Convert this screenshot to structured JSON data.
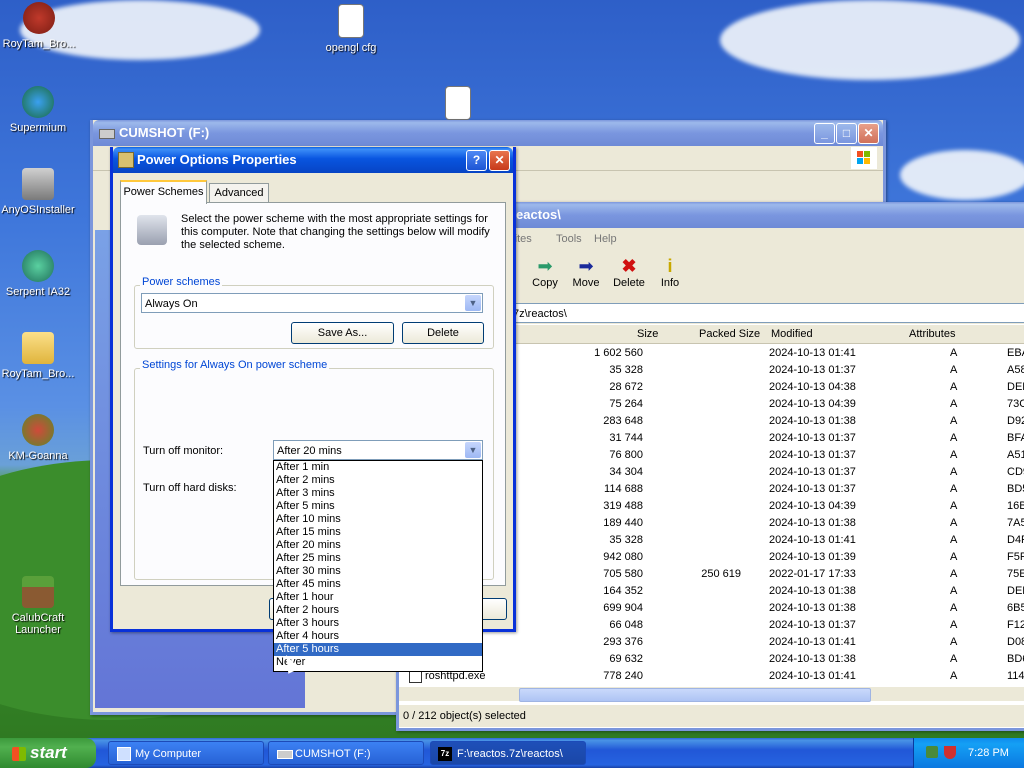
{
  "desktop": {
    "icons": [
      {
        "label": "RoyTam_Bro..."
      },
      {
        "label": "opengl cfg"
      },
      {
        "label": "Supermium"
      },
      {
        "label": "AnyOSInstaller"
      },
      {
        "label": "Serpent IA32"
      },
      {
        "label": "RoyTam_Bro..."
      },
      {
        "label": "KM-Goanna"
      },
      {
        "label": "CalubCraft Launcher"
      }
    ]
  },
  "explorer_window": {
    "title": "CUMSHOT (F:)"
  },
  "sevenzip_window": {
    "title": "reactos\\",
    "menu": [
      "rites",
      "Tools",
      "Help"
    ],
    "toolbar": [
      {
        "label": "Copy",
        "icon": "copy-icon"
      },
      {
        "label": "Move",
        "icon": "move-icon"
      },
      {
        "label": "Delete",
        "icon": "delete-icon"
      },
      {
        "label": "Info",
        "icon": "info-icon"
      }
    ],
    "path": "7z\\reactos\\",
    "columns": [
      "Size",
      "Packed Size",
      "Modified",
      "Attributes"
    ],
    "rows": [
      {
        "name": "",
        "size": "1 602 560",
        "packed": "",
        "modified": "2024-10-13 01:41",
        "attr": "A",
        "crc": "EBA"
      },
      {
        "name": "",
        "size": "35 328",
        "packed": "",
        "modified": "2024-10-13 01:37",
        "attr": "A",
        "crc": "A58"
      },
      {
        "name": "",
        "size": "28 672",
        "packed": "",
        "modified": "2024-10-13 04:38",
        "attr": "A",
        "crc": "DED"
      },
      {
        "name": "",
        "size": "75 264",
        "packed": "",
        "modified": "2024-10-13 04:39",
        "attr": "A",
        "crc": "73C"
      },
      {
        "name": "",
        "size": "283 648",
        "packed": "",
        "modified": "2024-10-13 01:38",
        "attr": "A",
        "crc": "D92"
      },
      {
        "name": "",
        "size": "31 744",
        "packed": "",
        "modified": "2024-10-13 01:37",
        "attr": "A",
        "crc": "BFA"
      },
      {
        "name": "",
        "size": "76 800",
        "packed": "",
        "modified": "2024-10-13 01:37",
        "attr": "A",
        "crc": "A51"
      },
      {
        "name": "",
        "size": "34 304",
        "packed": "",
        "modified": "2024-10-13 01:37",
        "attr": "A",
        "crc": "CD9"
      },
      {
        "name": "",
        "size": "114 688",
        "packed": "",
        "modified": "2024-10-13 01:37",
        "attr": "A",
        "crc": "BD5"
      },
      {
        "name": "",
        "size": "319 488",
        "packed": "",
        "modified": "2024-10-13 04:39",
        "attr": "A",
        "crc": "16B"
      },
      {
        "name": "",
        "size": "189 440",
        "packed": "",
        "modified": "2024-10-13 01:38",
        "attr": "A",
        "crc": "7A5"
      },
      {
        "name": "",
        "size": "35 328",
        "packed": "",
        "modified": "2024-10-13 01:41",
        "attr": "A",
        "crc": "D4F"
      },
      {
        "name": "",
        "size": "942 080",
        "packed": "",
        "modified": "2024-10-13 01:39",
        "attr": "A",
        "crc": "F5F"
      },
      {
        "name": "av",
        "size": "705 580",
        "packed": "250 619",
        "modified": "2022-01-17 17:33",
        "attr": "A",
        "crc": "75E"
      },
      {
        "name": "",
        "size": "164 352",
        "packed": "",
        "modified": "2024-10-13 01:38",
        "attr": "A",
        "crc": "DED"
      },
      {
        "name": "",
        "size": "699 904",
        "packed": "",
        "modified": "2024-10-13 01:38",
        "attr": "A",
        "crc": "6B5"
      },
      {
        "name": "",
        "size": "66 048",
        "packed": "",
        "modified": "2024-10-13 01:37",
        "attr": "A",
        "crc": "F12"
      },
      {
        "name": "",
        "size": "293 376",
        "packed": "",
        "modified": "2024-10-13 01:41",
        "attr": "A",
        "crc": "D08"
      },
      {
        "name": "e",
        "size": "69 632",
        "packed": "",
        "modified": "2024-10-13 01:38",
        "attr": "A",
        "crc": "BD6"
      },
      {
        "name": "roshttpd.exe",
        "size": "778 240",
        "packed": "",
        "modified": "2024-10-13 01:41",
        "attr": "A",
        "crc": "114"
      }
    ],
    "status": "0 / 212 object(s) selected"
  },
  "dialog": {
    "title": "Power Options Properties",
    "tabs": [
      "Power Schemes",
      "Advanced"
    ],
    "description": "Select the power scheme with the most appropriate settings for this computer. Note that changing the settings below will modify the selected scheme.",
    "schemes_group": "Power schemes",
    "scheme_value": "Always On",
    "save_as": "Save As...",
    "delete": "Delete",
    "settings_group": "Settings for Always On power scheme",
    "monitor_label": "Turn off monitor:",
    "monitor_value": "After 20 mins",
    "disks_label": "Turn off hard disks:",
    "dropdown_options": [
      "After 1 min",
      "After 2 mins",
      "After 3 mins",
      "After 5 mins",
      "After 10 mins",
      "After 15 mins",
      "After 20 mins",
      "After 25 mins",
      "After 30 mins",
      "After 45 mins",
      "After 1 hour",
      "After 2 hours",
      "After 3 hours",
      "After 4 hours",
      "After 5 hours",
      "Never"
    ],
    "dropdown_selected": "After 5 hours"
  },
  "taskbar": {
    "start": "start",
    "items": [
      "My Computer",
      "CUMSHOT (F:)",
      "F:\\reactos.7z\\reactos\\"
    ],
    "clock": "7:28 PM"
  }
}
